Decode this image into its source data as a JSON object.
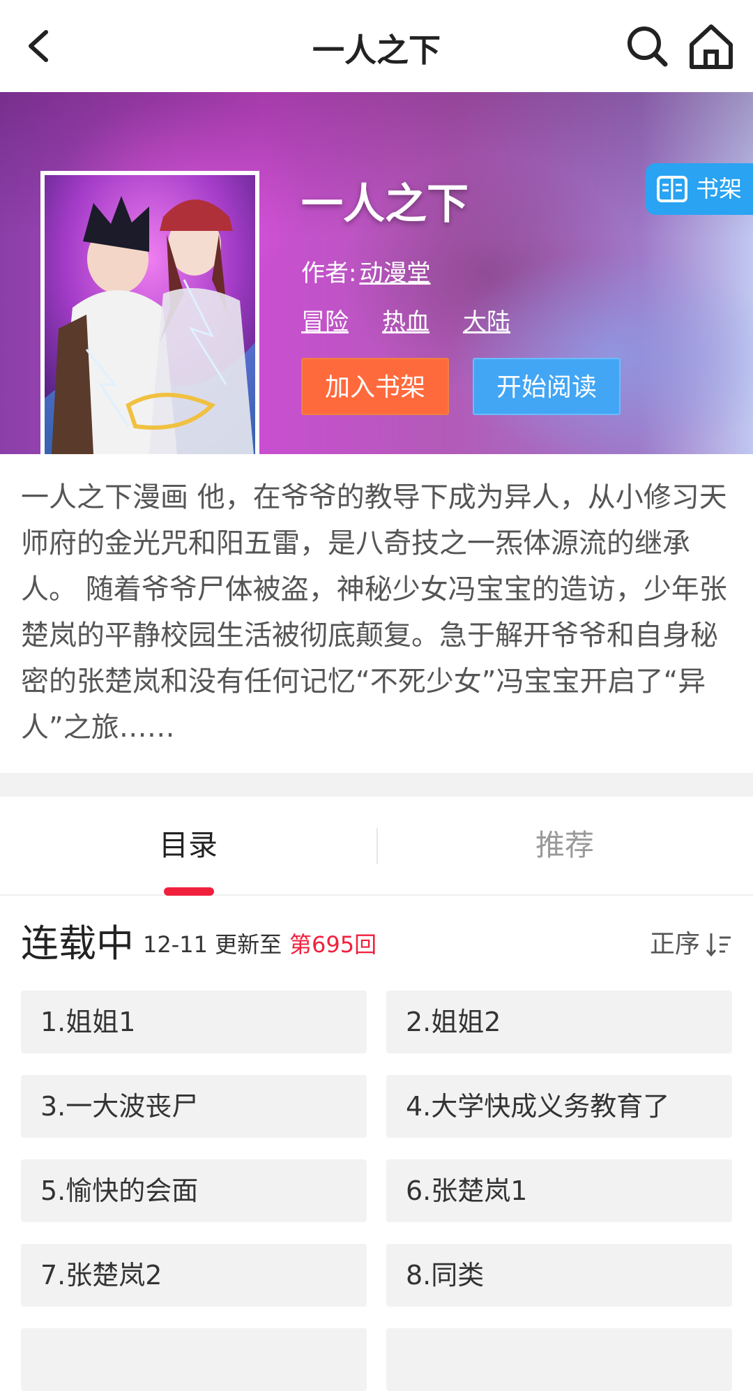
{
  "header": {
    "title": "一人之下"
  },
  "book": {
    "title": "一人之下",
    "author_label": "作者:",
    "author": "动漫堂",
    "tags": [
      "冒险",
      "热血",
      "大陆"
    ],
    "add_button": "加入书架",
    "read_button": "开始阅读",
    "shelf_badge": "书架",
    "description": "一人之下漫画 他，在爷爷的教导下成为异人，从小修习天师府的金光咒和阳五雷，是八奇技之一炁体源流的继承人。 随着爷爷尸体被盗，神秘少女冯宝宝的造访，少年张楚岚的平静校园生活被彻底颠复。急于解开爷爷和自身秘密的张楚岚和没有任何记忆“不死少女”冯宝宝开启了“异人”之旅……"
  },
  "tabs": [
    {
      "label": "目录",
      "active": true
    },
    {
      "label": "推荐",
      "active": false
    }
  ],
  "catalog": {
    "status": "连载中",
    "update_text": "12-11 更新至",
    "latest": "第695回",
    "sort_label": "正序",
    "chapters": [
      "1.姐姐1",
      "2.姐姐2",
      "3.一大波丧尸",
      "4.大学快成义务教育了",
      "5.愉快的会面",
      "6.张楚岚1",
      "7.张楚岚2",
      "8.同类"
    ]
  },
  "colors": {
    "accent_red": "#f0203c",
    "add_button": "#ff6a3d",
    "read_button": "#42a6f5",
    "shelf_badge": "#29a3f2"
  },
  "icons": [
    "back-arrow-icon",
    "search-icon",
    "home-icon",
    "book-open-icon",
    "sort-ascending-icon"
  ]
}
